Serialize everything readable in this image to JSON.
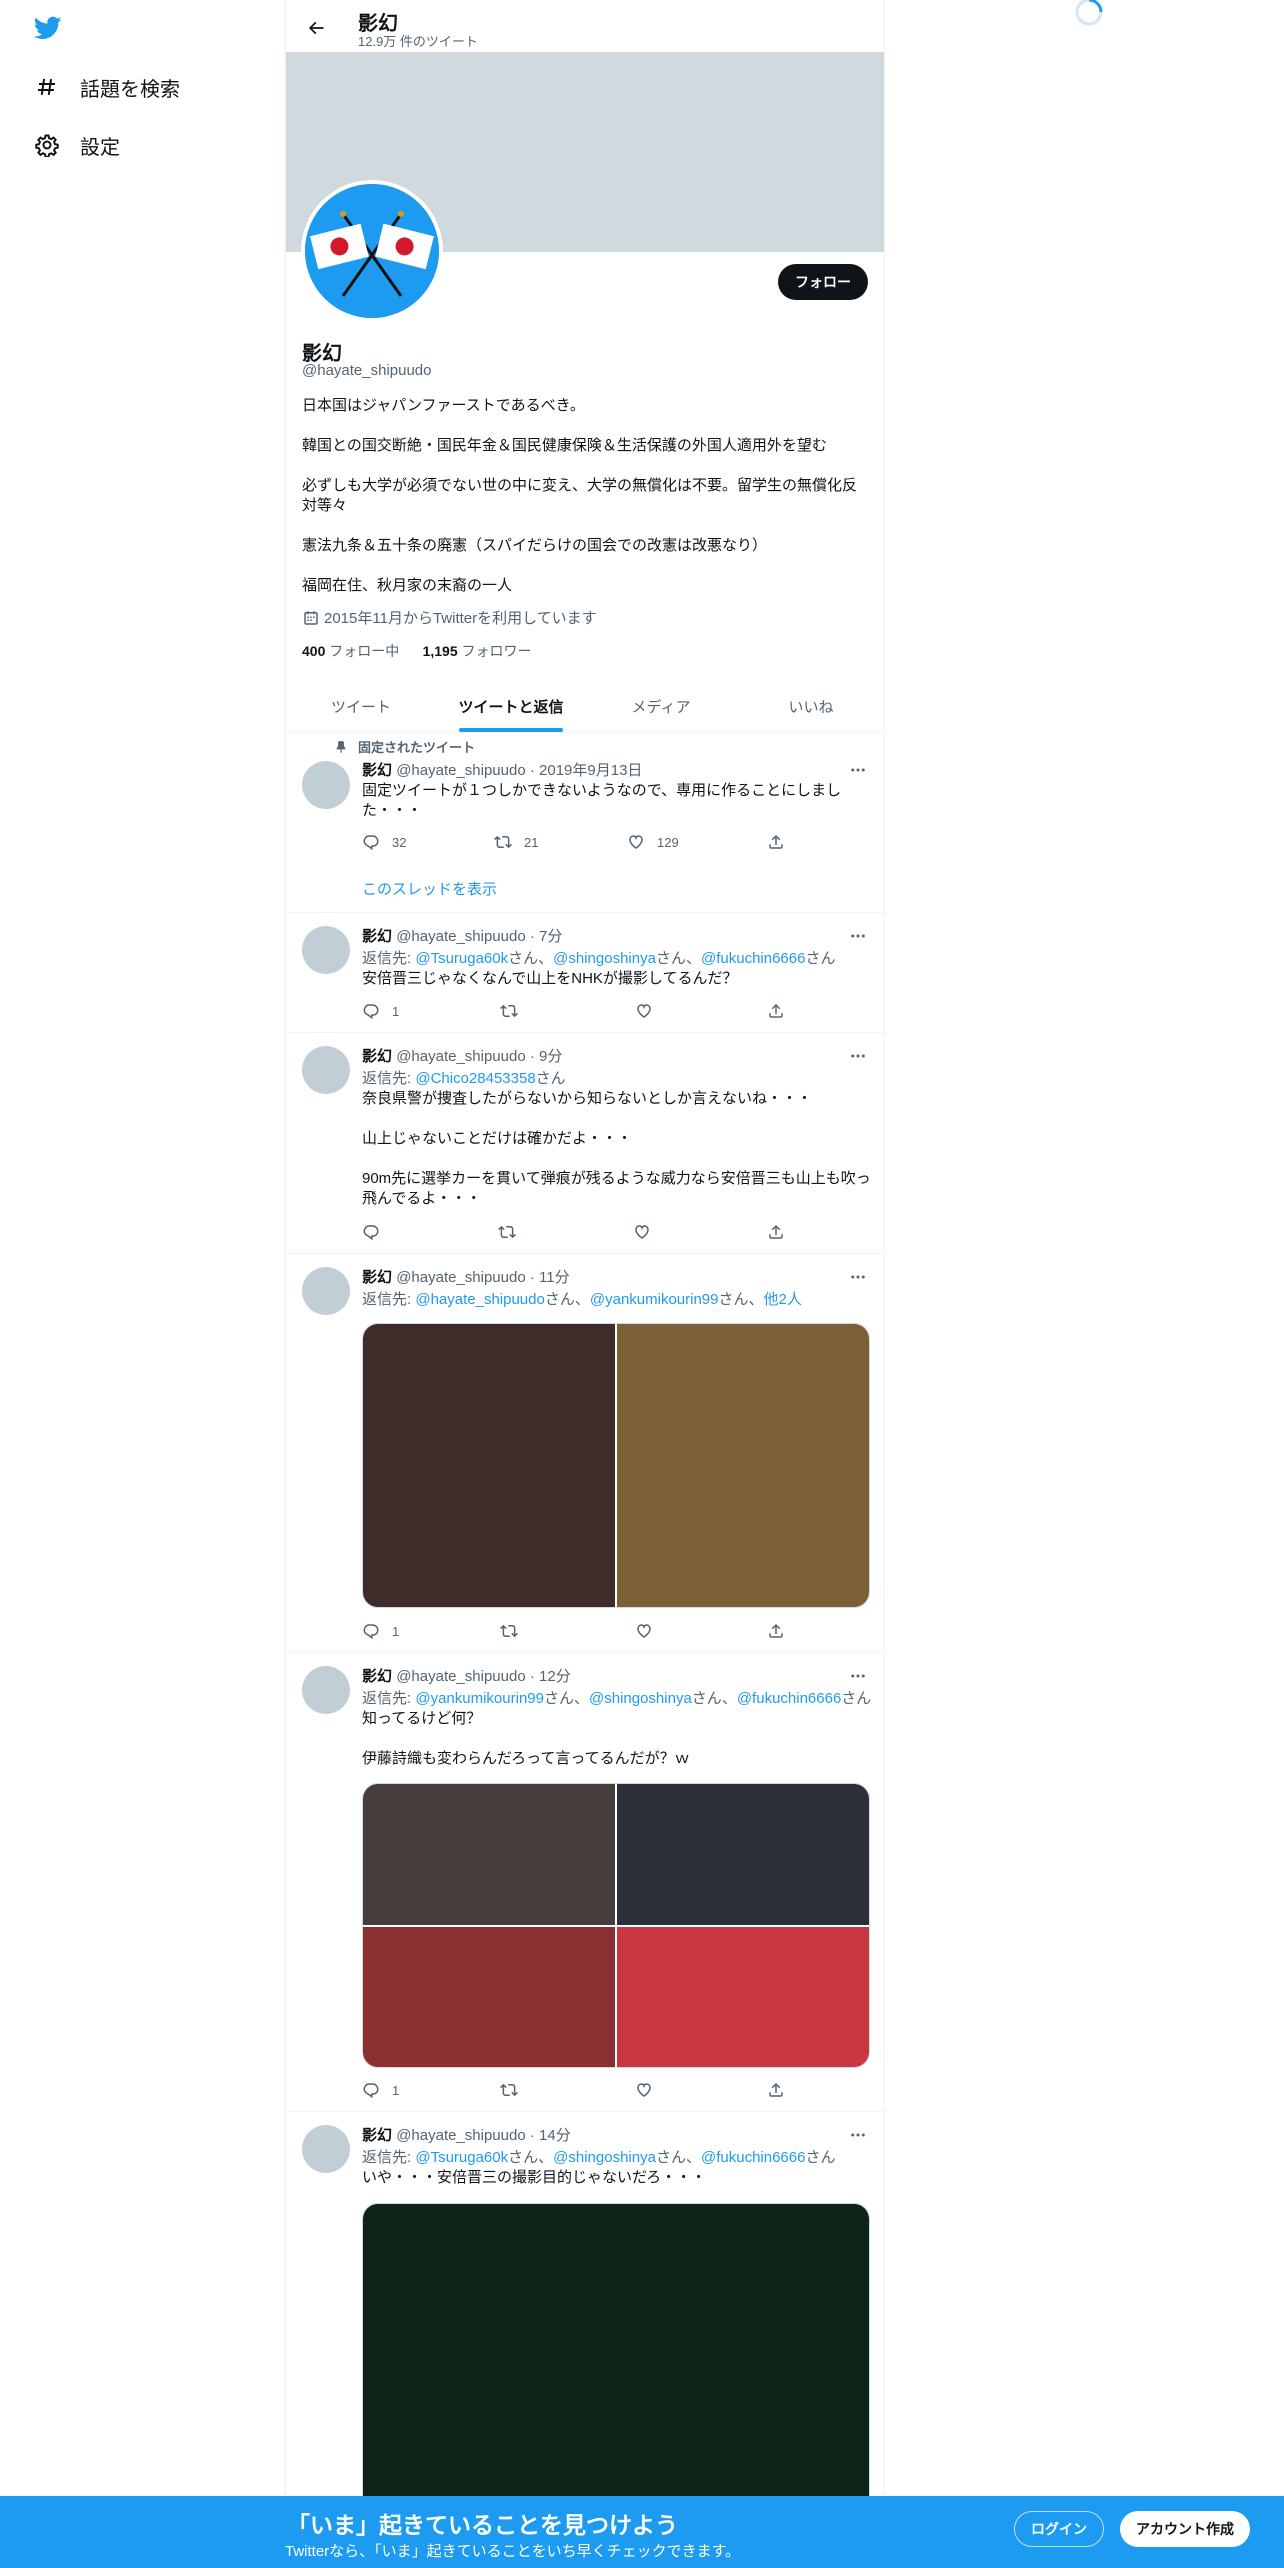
{
  "nav": {
    "items": [
      {
        "label": "話題を検索",
        "icon": "hashtag-icon"
      },
      {
        "label": "設定",
        "icon": "gear-icon"
      }
    ]
  },
  "header": {
    "name": "影幻",
    "tweet_count": "12.9万 件のツイート"
  },
  "profile": {
    "follow_label": "フォロー",
    "name": "影幻",
    "handle": "@hayate_shipuudo",
    "bio": [
      "日本国はジャパンファーストであるべき。",
      "韓国との国交断絶・国民年金＆国民健康保険＆生活保護の外国人適用外を望む",
      "必ずしも大学が必須でない世の中に変え、大学の無償化は不要。留学生の無償化反対等々",
      "憲法九条＆五十条の廃憲（スパイだらけの国会での改憲は改悪なり）",
      "福岡在住、秋月家の末裔の一人"
    ],
    "joined": "2015年11月からTwitterを利用しています",
    "following_count": "400",
    "following_label": "フォロー中",
    "followers_count": "1,195",
    "followers_label": "フォロワー"
  },
  "tabs": [
    {
      "label": "ツイート",
      "active": false
    },
    {
      "label": "ツイートと返信",
      "active": true
    },
    {
      "label": "メディア",
      "active": false
    },
    {
      "label": "いいね",
      "active": false
    }
  ],
  "tweets": [
    {
      "pinned_label": "固定されたツイート",
      "name": "影幻",
      "meta": "@hayate_shipuudo · 2019年9月13日",
      "text": "固定ツイートが１つしかできないようなので、専用に作ることにしました・・・",
      "replies": "32",
      "retweets": "21",
      "likes": "129",
      "thread_link": "このスレッドを表示"
    },
    {
      "name": "影幻",
      "meta": "@hayate_shipuudo · 7分",
      "reply_prefix": "返信先: ",
      "reply_to": [
        "@Tsuruga60k",
        "@shingoshinya",
        "@fukuchin6666"
      ],
      "san": "さん",
      "sep": "、",
      "text": "安倍晋三じゃなくなんで山上をNHKが撮影してるんだ？",
      "replies": "1",
      "retweets": "",
      "likes": ""
    },
    {
      "name": "影幻",
      "meta": "@hayate_shipuudo · 9分",
      "reply_prefix": "返信先: ",
      "reply_to": [
        "@Chico28453358"
      ],
      "san": "さん",
      "text": [
        "奈良県警が捜査したがらないから知らないとしか言えないね・・・",
        "山上じゃないことだけは確かだよ・・・",
        "90m先に選挙カーを貫いて弾痕が残るような威力なら安倍晋三も山上も吹っ飛んでるよ・・・"
      ],
      "replies": "",
      "retweets": "",
      "likes": ""
    },
    {
      "name": "影幻",
      "meta": "@hayate_shipuudo · 11分",
      "reply_prefix": "返信先: ",
      "reply_to": [
        "@hayate_shipuudo",
        "@yankumikourin99"
      ],
      "san": "さん",
      "sep": "、",
      "others": "他2人",
      "media_colors": [
        "#3e2c2b",
        "#7d5f36"
      ],
      "replies": "1",
      "retweets": "",
      "likes": ""
    },
    {
      "name": "影幻",
      "meta": "@hayate_shipuudo · 12分",
      "reply_prefix": "返信先: ",
      "reply_to": [
        "@yankumikourin99",
        "@shingoshinya",
        "@fukuchin6666"
      ],
      "san": "さん",
      "sep": "、",
      "text": [
        "知ってるけど何？",
        "伊藤詩織も変わらんだろって言ってるんだが？ｗ"
      ],
      "media_colors": [
        "#463e3c",
        "#2c2f39",
        "#8a3030",
        "#c93842"
      ],
      "replies": "1",
      "retweets": "",
      "likes": ""
    },
    {
      "name": "影幻",
      "meta": "@hayate_shipuudo · 14分",
      "reply_prefix": "返信先: ",
      "reply_to": [
        "@Tsuruga60k",
        "@shingoshinya",
        "@fukuchin6666"
      ],
      "san": "さん",
      "sep": "、",
      "text": "いや・・・安倍晋三の撮影目的じゃないだろ・・・",
      "media_colors": [
        "#0e2416"
      ]
    }
  ],
  "bottom_bar": {
    "title": "「いま」起きていることを見つけよう",
    "subtitle": "Twitterなら、「いま」起きていることをいち早くチェックできます。",
    "login": "ログイン",
    "signup": "アカウント作成"
  },
  "colors": {
    "accent": "#1d9bf0",
    "banner": "#cfd9de",
    "avatar_placeholder": "#c2ced5",
    "text": "#0f1419",
    "muted": "#536471"
  }
}
